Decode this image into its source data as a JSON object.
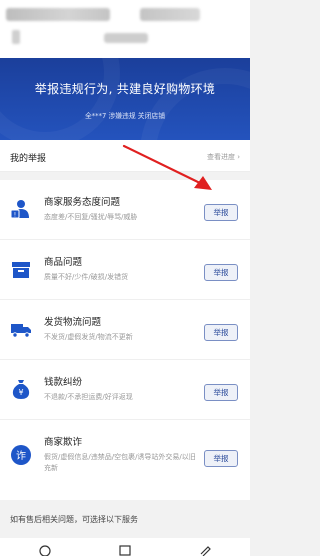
{
  "banner": {
    "title": "举报违规行为, 共建良好购物环境",
    "subtitle": "全***7 涉嫌违规 关闭店铺"
  },
  "my_reports": {
    "title": "我的举报",
    "progress_link": "查看进度 ›"
  },
  "items": [
    {
      "name": "商家服务态度问题",
      "desc": "态度差/不回复/骚扰/辱骂/威胁",
      "button": "举报",
      "icon": "user-icon",
      "color": "#1e56c8"
    },
    {
      "name": "商品问题",
      "desc": "质量不好/少件/破损/发错货",
      "button": "举报",
      "icon": "box-icon",
      "color": "#1e56c8"
    },
    {
      "name": "发货物流问题",
      "desc": "不发货/虚假发货/物流不更新",
      "button": "举报",
      "icon": "truck-icon",
      "color": "#1e56c8"
    },
    {
      "name": "钱款纠纷",
      "desc": "不退款/不承担运费/好评返现",
      "button": "举报",
      "icon": "money-bag-icon",
      "color": "#1e56c8"
    },
    {
      "name": "商家欺诈",
      "desc": "假货/虚假信息/违禁品/空包裹/诱导站外交易/以旧充新",
      "button": "举报",
      "icon": "fraud-icon",
      "color": "#1e56c8"
    }
  ],
  "footer": {
    "text": "如有售后相关问题，可选择以下服务"
  }
}
